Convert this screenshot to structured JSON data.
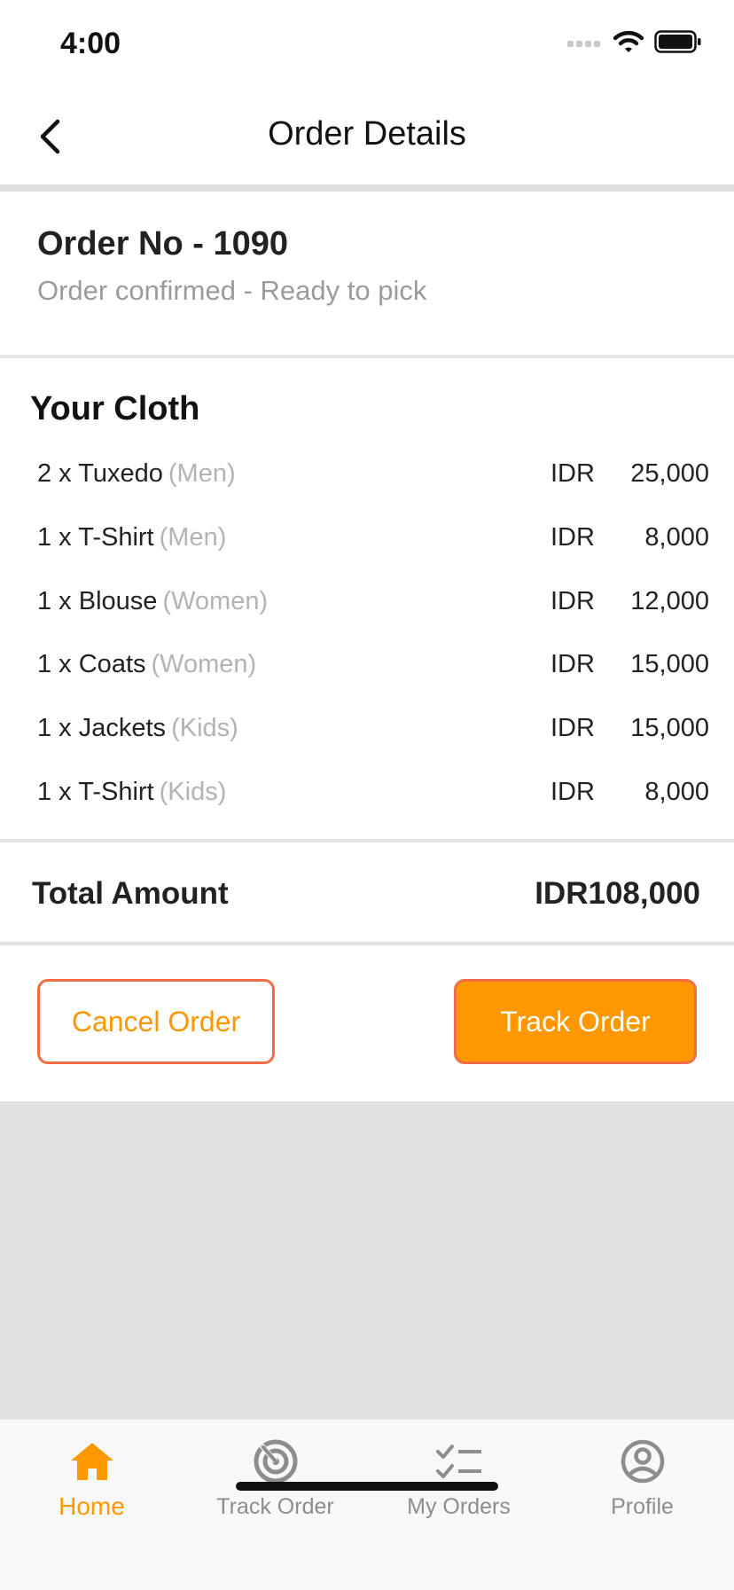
{
  "status_bar": {
    "time": "4:00"
  },
  "app_bar": {
    "title": "Order Details",
    "back_icon": "back-chevron-icon"
  },
  "order": {
    "number_label": "Order No - 1090",
    "status_text": "Order confirmed - Ready to pick"
  },
  "cloth": {
    "title": "Your Cloth",
    "items": [
      {
        "name": "2 x Tuxedo",
        "category": "(Men)",
        "currency": "IDR",
        "amount": "25,000"
      },
      {
        "name": "1 x T-Shirt",
        "category": "(Men)",
        "currency": "IDR",
        "amount": "8,000"
      },
      {
        "name": "1 x Blouse",
        "category": "(Women)",
        "currency": "IDR",
        "amount": "12,000"
      },
      {
        "name": "1 x Coats",
        "category": "(Women)",
        "currency": "IDR",
        "amount": "15,000"
      },
      {
        "name": "1 x Jackets",
        "category": "(Kids)",
        "currency": "IDR",
        "amount": "15,000"
      },
      {
        "name": "1 x T-Shirt",
        "category": "(Kids)",
        "currency": "IDR",
        "amount": "8,000"
      }
    ]
  },
  "total": {
    "label": "Total Amount",
    "value": "IDR108,000"
  },
  "actions": {
    "cancel_label": "Cancel Order",
    "track_label": "Track Order"
  },
  "tabs": [
    {
      "label": "Home",
      "icon": "home-icon",
      "active": true
    },
    {
      "label": "Track Order",
      "icon": "radar-icon",
      "active": false
    },
    {
      "label": "My Orders",
      "icon": "checklist-icon",
      "active": false
    },
    {
      "label": "Profile",
      "icon": "profile-icon",
      "active": false
    }
  ],
  "colors": {
    "accent": "#ff9800",
    "button_border": "#f36c43",
    "muted_text": "#9b9b9b",
    "background": "#e0e0e0"
  }
}
